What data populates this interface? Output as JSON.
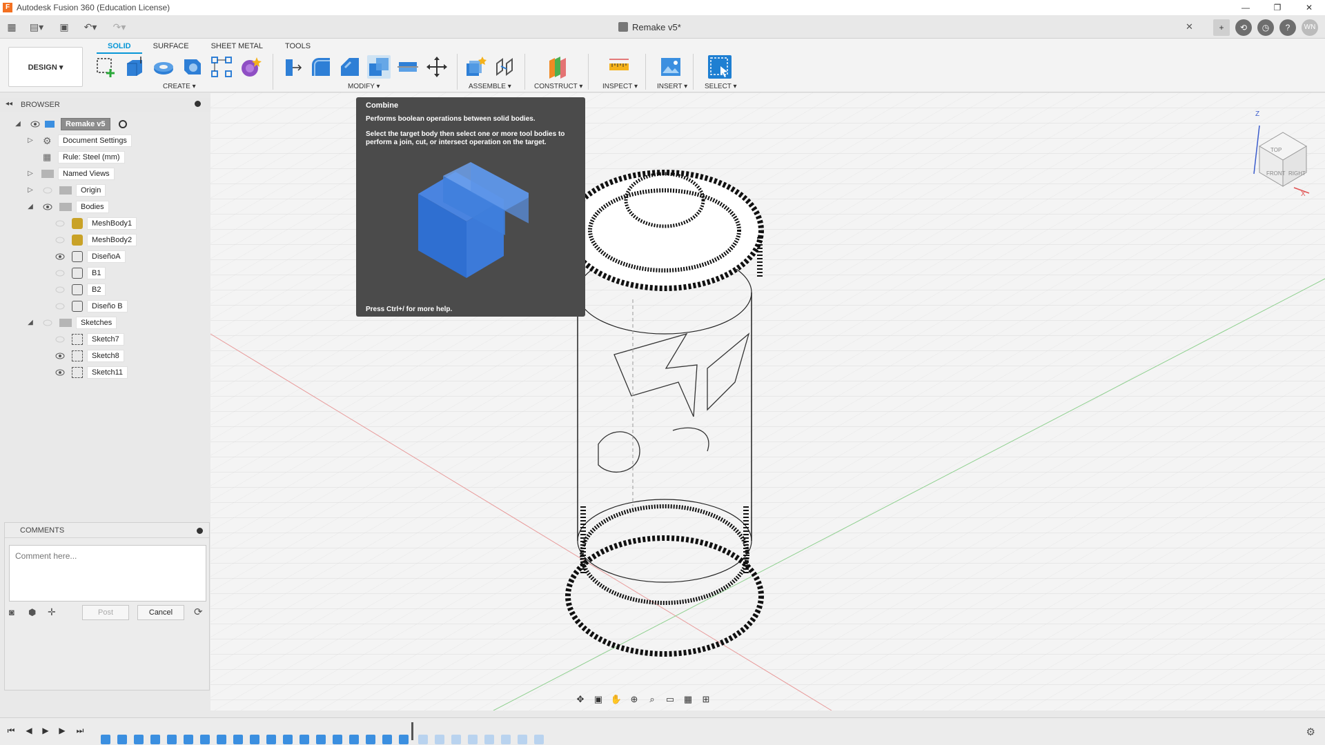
{
  "window": {
    "title": "Autodesk Fusion 360 (Education License)",
    "controls": [
      "—",
      "❐",
      "✕"
    ]
  },
  "quick_access": {
    "doc_title": "Remake v5*",
    "close_glyph": "✕",
    "avatar": "WN"
  },
  "ribbon": {
    "tabs": [
      "SOLID",
      "SURFACE",
      "SHEET METAL",
      "TOOLS"
    ],
    "workspace": "DESIGN ▾",
    "groups": {
      "create": "CREATE ▾",
      "modify": "MODIFY ▾",
      "assemble": "ASSEMBLE ▾",
      "construct": "CONSTRUCT ▾",
      "inspect": "INSPECT ▾",
      "insert": "INSERT ▾",
      "select": "SELECT ▾"
    }
  },
  "browser": {
    "title": "BROWSER",
    "root": "Remake v5",
    "items": [
      "Document Settings",
      "Rule: Steel (mm)",
      "Named Views",
      "Origin",
      "Bodies",
      "MeshBody1",
      "MeshBody2",
      "DiseñoA",
      "B1",
      "B2",
      "Diseño B",
      "Sketches",
      "Sketch7",
      "Sketch8",
      "Sketch11"
    ]
  },
  "comments": {
    "title": "COMMENTS",
    "placeholder": "Comment here...",
    "post": "Post",
    "cancel": "Cancel"
  },
  "tooltip": {
    "title": "Combine",
    "description": "Performs boolean operations between solid bodies.",
    "body": "Select the target body then select one or more tool bodies to perform a join, cut, or intersect operation on the target.",
    "help": "Press Ctrl+/ for more help."
  },
  "viewcube": {
    "top": "TOP",
    "front": "FRONT",
    "right": "RIGHT",
    "axis_z": "Z",
    "axis_x": "X"
  },
  "colors": {
    "accent": "#0696d7",
    "tooltip_bg": "#4b4b4b",
    "combine_blue": "#2f6fd1"
  }
}
